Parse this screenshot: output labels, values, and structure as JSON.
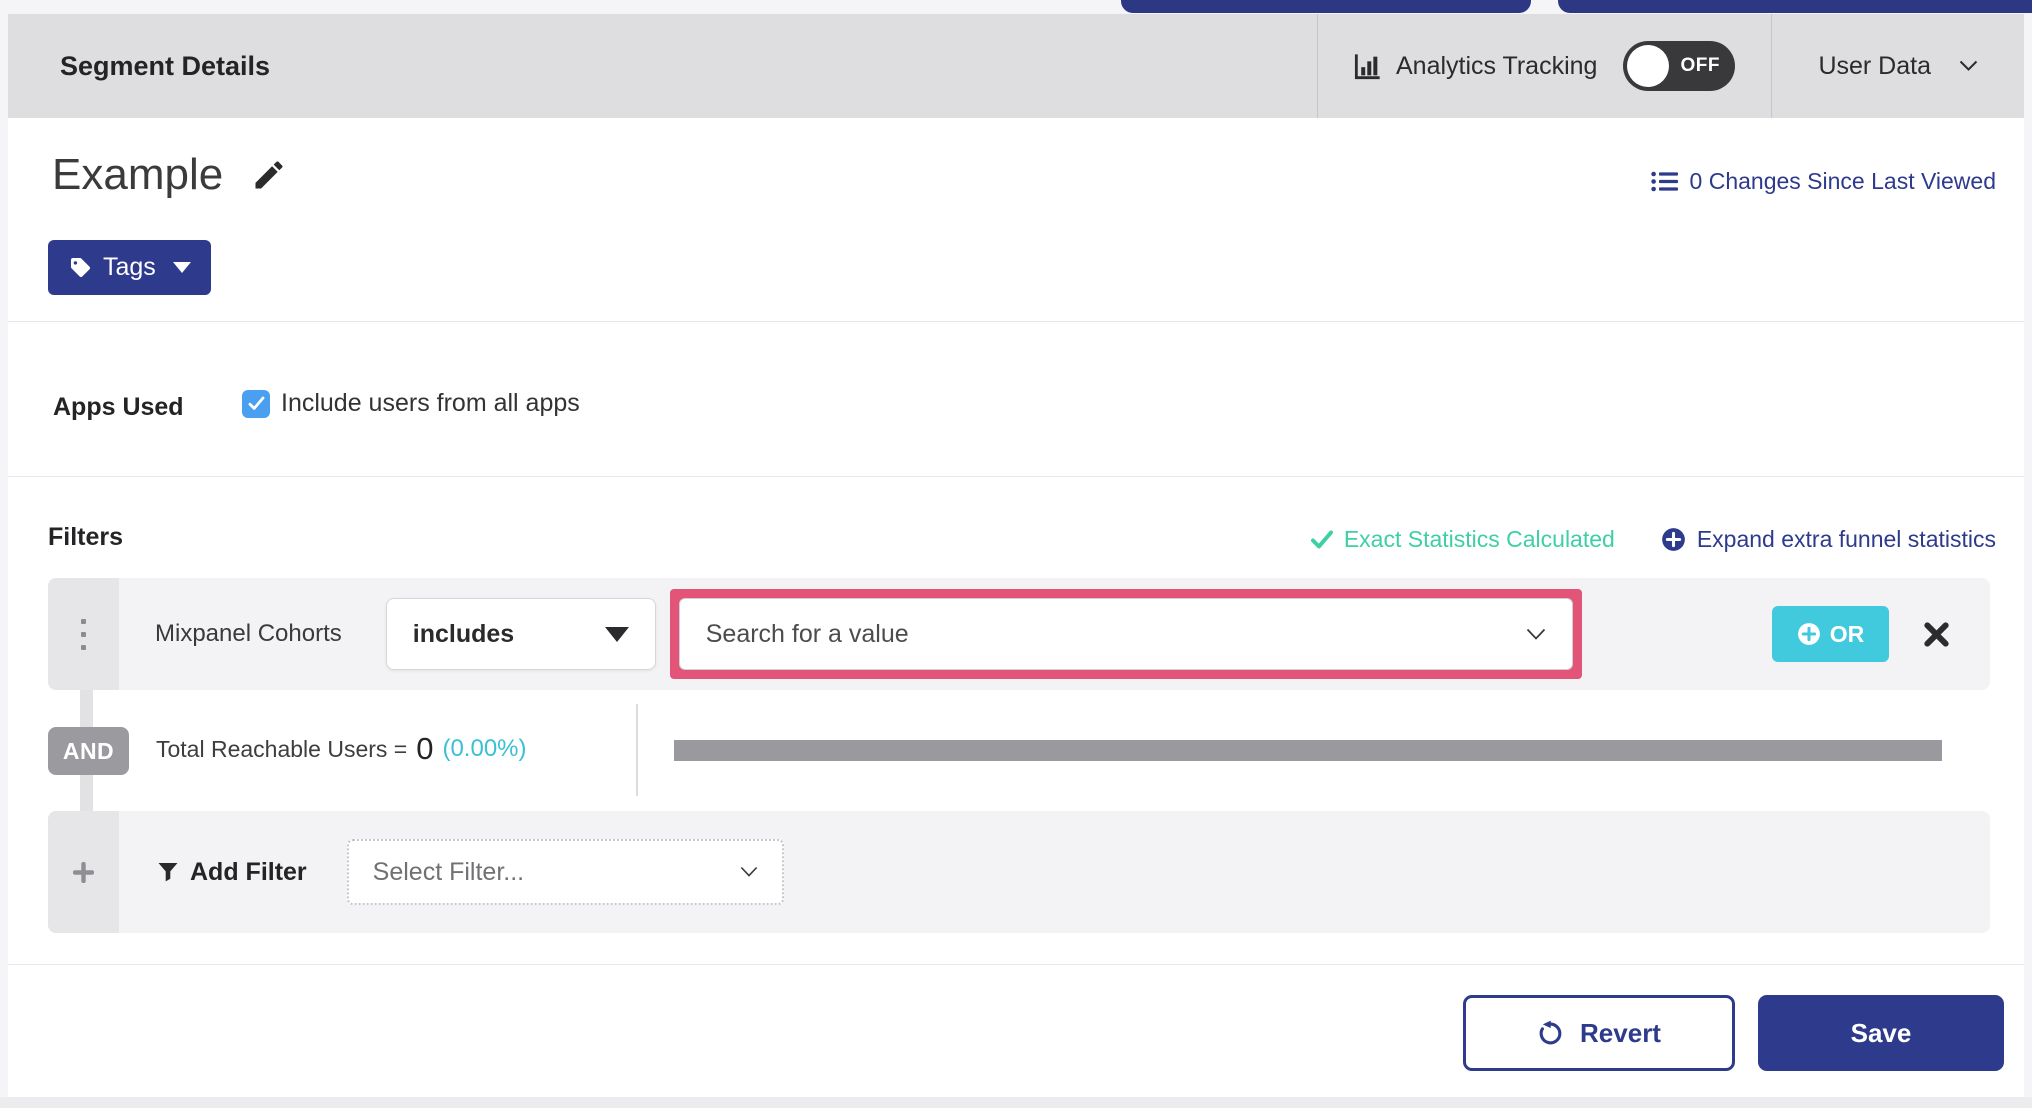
{
  "header": {
    "title": "Segment Details",
    "analytics_tracking_label": "Analytics Tracking",
    "toggle_state": "OFF",
    "user_data_label": "User Data"
  },
  "segment": {
    "name": "Example",
    "changes_link": "0 Changes Since Last Viewed",
    "tags_button": "Tags"
  },
  "apps_used": {
    "label": "Apps Used",
    "include_all_label": "Include users from all apps",
    "include_all_checked": true
  },
  "filters": {
    "heading": "Filters",
    "exact_statistics": "Exact Statistics Calculated",
    "expand_funnel": "Expand extra funnel statistics",
    "row": {
      "name": "Mixpanel Cohorts",
      "operator": "includes",
      "value_placeholder": "Search for a value",
      "or_button": "OR"
    },
    "conjunction": "AND",
    "reachable_label": "Total Reachable Users =",
    "reachable_count": "0",
    "reachable_percent": "(0.00%)",
    "add_filter_label": "Add Filter",
    "select_filter_placeholder": "Select Filter..."
  },
  "footer": {
    "revert": "Revert",
    "save": "Save"
  },
  "colors": {
    "brand_blue": "#2e3a8c",
    "or_teal": "#41c9de",
    "mint_green": "#3ecfa5",
    "percent_cyan": "#3bc0d4",
    "highlight_pink": "#e25578",
    "checkbox_blue": "#4a9ff0",
    "toggle_off_dark": "#39393b",
    "progress_gray": "#9a9a9e"
  }
}
